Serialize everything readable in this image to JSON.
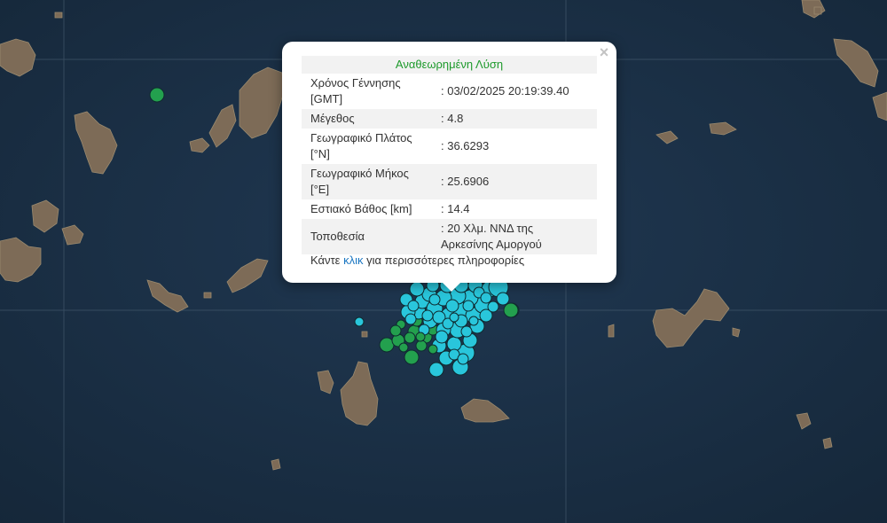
{
  "map": {
    "land_color": "#7a6a58",
    "sea_color": "#1b3046",
    "marker_colors": {
      "revised": "#23a04e",
      "automatic": "#29c6db",
      "stroke": "#0f2a2f"
    }
  },
  "popup": {
    "title": "Αναθεωρημένη Λύση",
    "close_icon": "×",
    "rows": [
      {
        "label": "Χρόνος Γέννησης [GMT]",
        "value": ": 03/02/2025 20:19:39.40"
      },
      {
        "label": "Μέγεθος",
        "value": ": 4.8"
      },
      {
        "label": "Γεωγραφικό Πλάτος [°N]",
        "value": ": 36.6293"
      },
      {
        "label": "Γεωγραφικό Μήκος [°E]",
        "value": ": 25.6906"
      },
      {
        "label": "Εστιακό Βάθος [km]",
        "value": ": 14.4"
      },
      {
        "label": "Τοποθεσία",
        "value": ": 20 Χλμ. ΝΝΔ της Αρκεσίνης Αμοργού"
      }
    ],
    "more_prefix": "Κάντε",
    "more_link": "κλικ",
    "more_suffix": "για περισσότερες πληροφορίες"
  }
}
